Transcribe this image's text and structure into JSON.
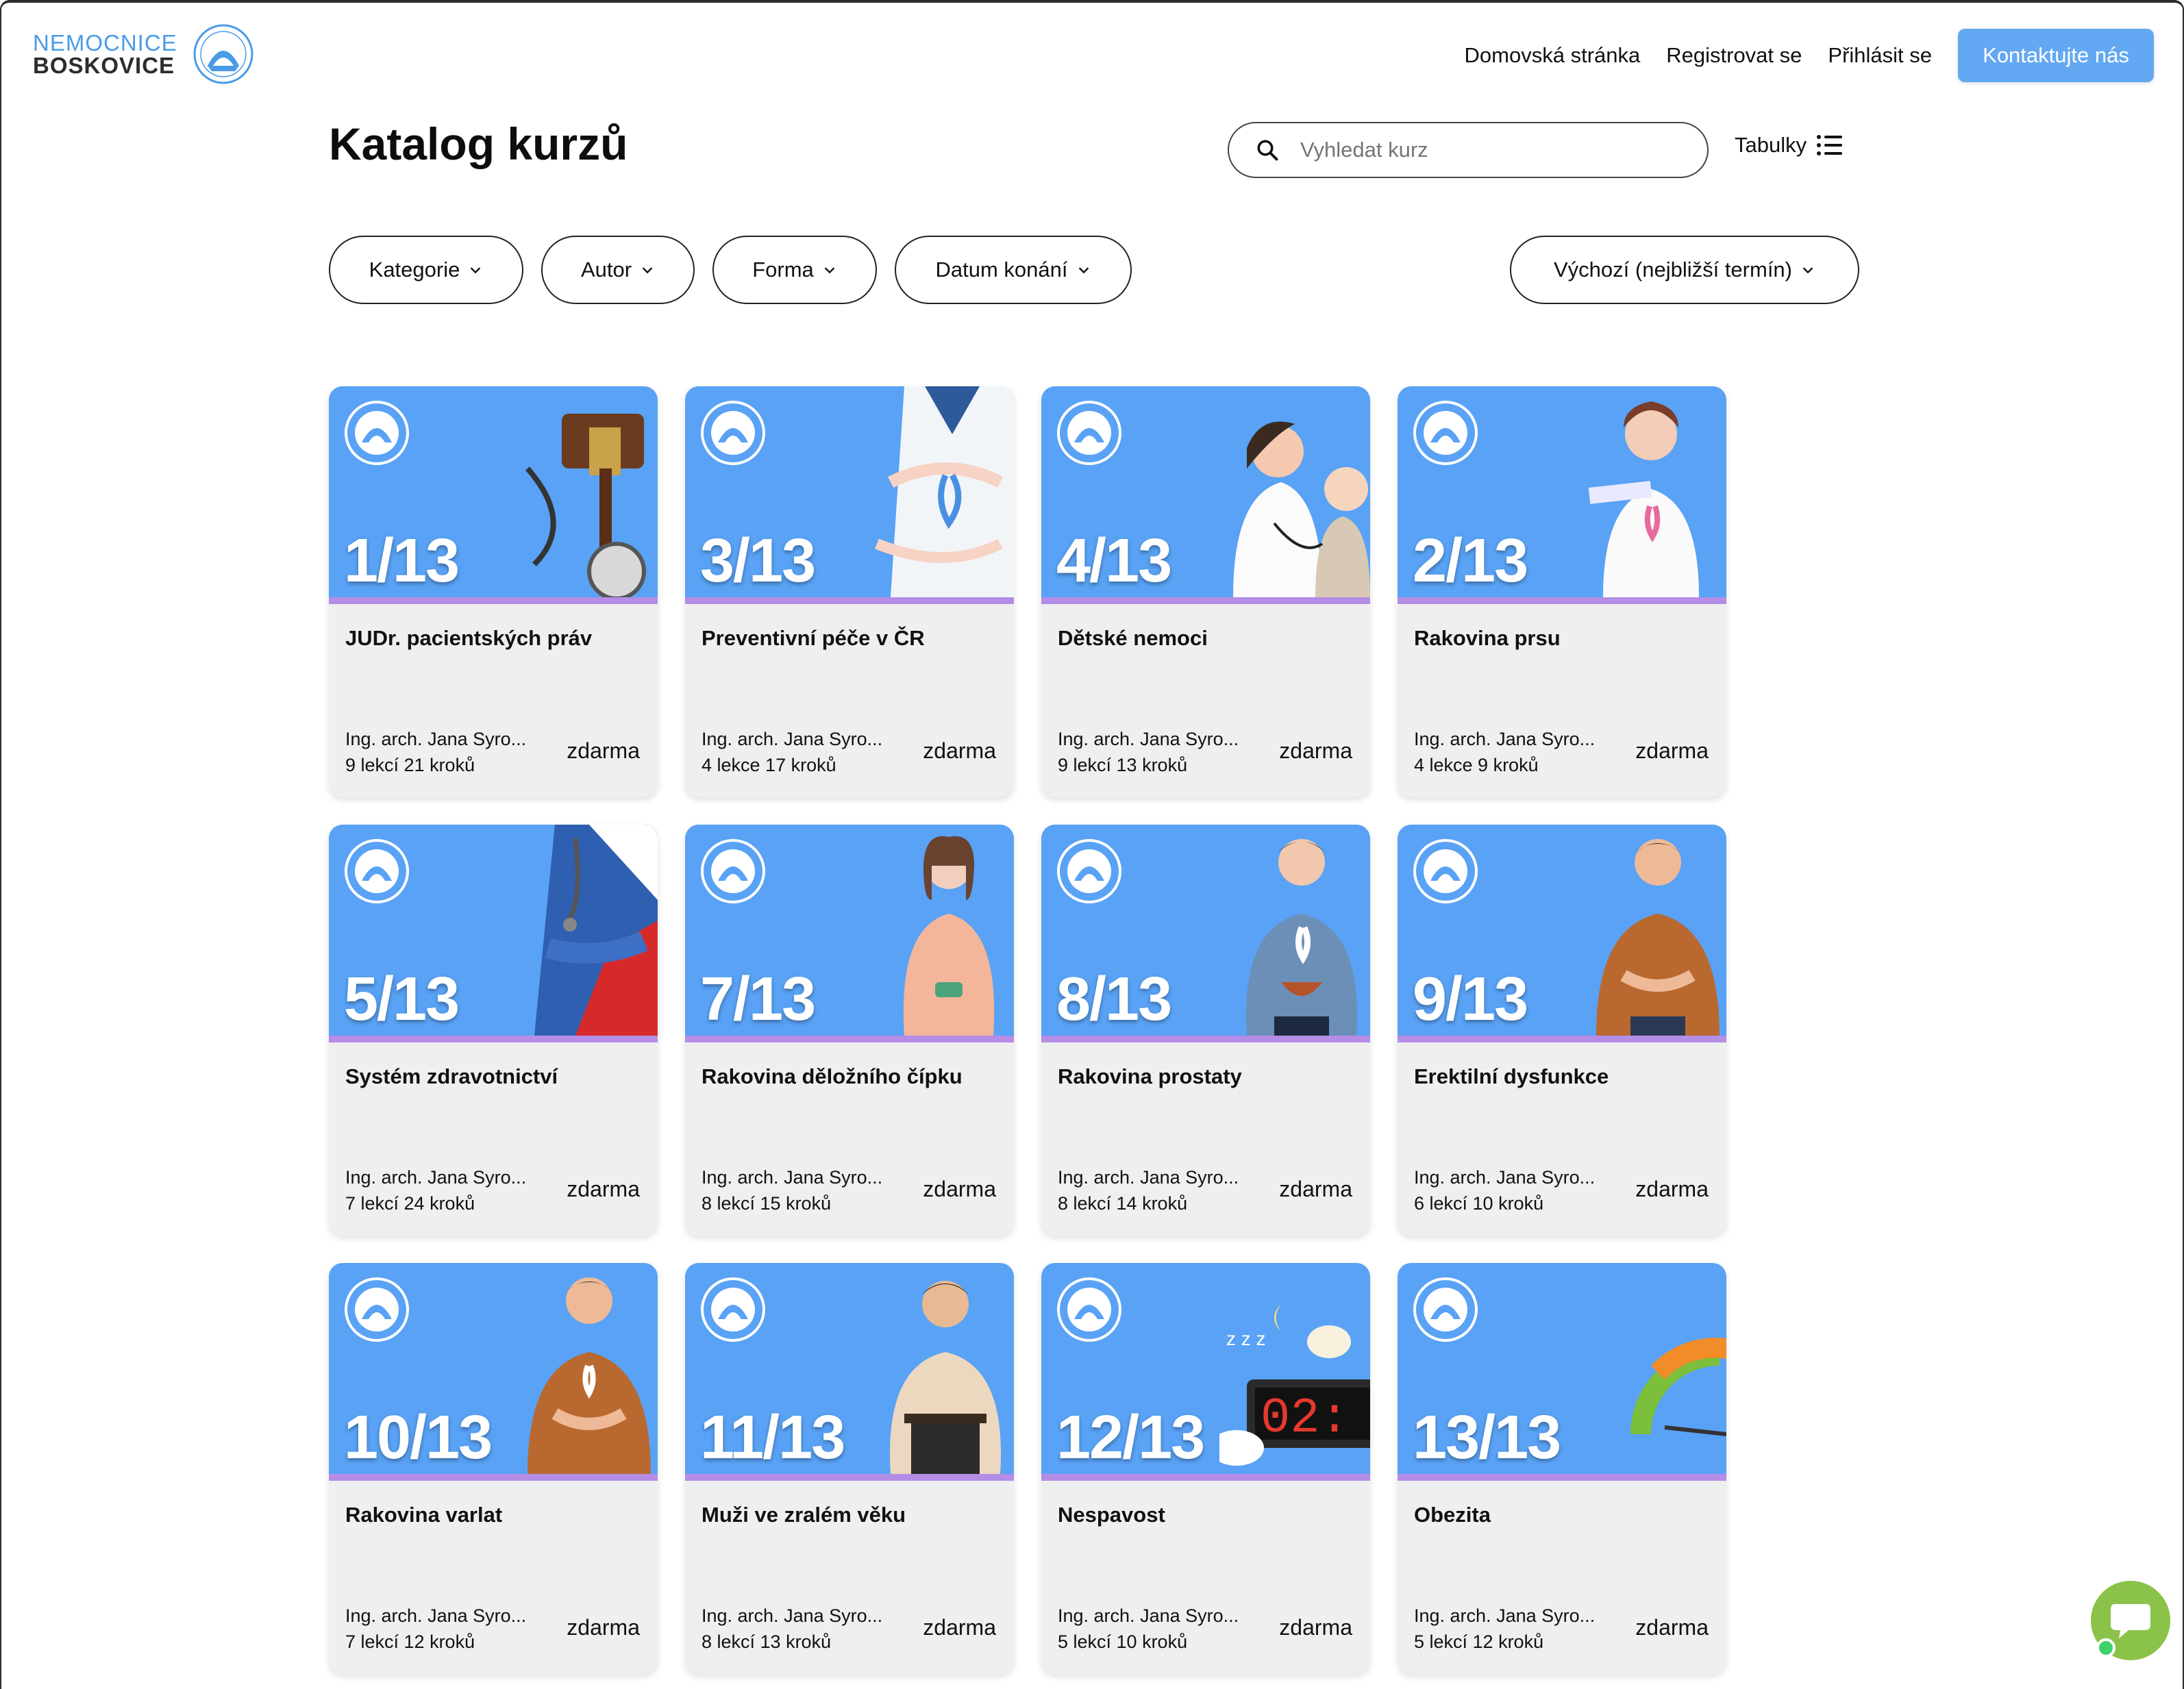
{
  "header": {
    "logo_line1": "NEMOCNICE",
    "logo_line2": "BOSKOVICE",
    "nav": [
      "Domovská stránka",
      "Registrovat se",
      "Přihlásit se"
    ],
    "contact_label": "Kontaktujte nás"
  },
  "page": {
    "title": "Katalog kurzů",
    "search_placeholder": "Vyhledat kurz",
    "tables_label": "Tabulky"
  },
  "filters": {
    "category": "Kategorie",
    "author": "Autor",
    "form": "Forma",
    "date": "Datum konání",
    "sort": "Výchozí (nejbližší termín)"
  },
  "colors": {
    "accent": "#63a8f2",
    "card_image_bg": "#59a2f5",
    "card_stripe": "#b48de6",
    "chat": "#8bc34a"
  },
  "courses": [
    {
      "num": "1/13",
      "title": "JUDr. pacientských práv",
      "author": "Ing. arch. Jana Syro...",
      "stats": "9 lekcí 21 kroků",
      "price": "zdarma",
      "icon": "gavel-stethoscope-image"
    },
    {
      "num": "3/13",
      "title": "Preventivní péče v ČR",
      "author": "Ing. arch. Jana Syro...",
      "stats": "4 lekce 17 kroků",
      "price": "zdarma",
      "icon": "doctor-ribbon-image"
    },
    {
      "num": "4/13",
      "title": "Dětské nemoci",
      "author": "Ing. arch. Jana Syro...",
      "stats": "9 lekcí 13 kroků",
      "price": "zdarma",
      "icon": "doctor-child-image"
    },
    {
      "num": "2/13",
      "title": "Rakovina prsu",
      "author": "Ing. arch. Jana Syro...",
      "stats": "4 lekce 9 kroků",
      "price": "zdarma",
      "icon": "doctor-pink-ribbon-image"
    },
    {
      "num": "5/13",
      "title": "Systém zdravotnictví",
      "author": "Ing. arch. Jana Syro...",
      "stats": "7 lekcí 24 kroků",
      "price": "zdarma",
      "icon": "doctor-flag-image"
    },
    {
      "num": "7/13",
      "title": "Rakovina děložního čípku",
      "author": "Ing. arch. Jana Syro...",
      "stats": "8 lekcí 15 kroků",
      "price": "zdarma",
      "icon": "woman-image"
    },
    {
      "num": "8/13",
      "title": "Rakovina prostaty",
      "author": "Ing. arch. Jana Syro...",
      "stats": "8 lekcí 14 kroků",
      "price": "zdarma",
      "icon": "man-ribbon-image"
    },
    {
      "num": "9/13",
      "title": "Erektilní dysfunkce",
      "author": "Ing. arch. Jana Syro...",
      "stats": "6 lekcí 10 kroků",
      "price": "zdarma",
      "icon": "man-orange-shirt-image"
    },
    {
      "num": "10/13",
      "title": "Rakovina varlat",
      "author": "Ing. arch. Jana Syro...",
      "stats": "7 lekcí 12 kroků",
      "price": "zdarma",
      "icon": "man-ribbon-orange-image"
    },
    {
      "num": "11/13",
      "title": "Muži ve zralém věku",
      "author": "Ing. arch. Jana Syro...",
      "stats": "8 lekcí 13 kroků",
      "price": "zdarma",
      "icon": "older-man-image"
    },
    {
      "num": "12/13",
      "title": "Nespavost",
      "author": "Ing. arch. Jana Syro...",
      "stats": "5 lekcí 10 kroků",
      "price": "zdarma",
      "icon": "alarm-clock-sheep-image",
      "clock": "02:"
    },
    {
      "num": "13/13",
      "title": "Obezita",
      "author": "Ing. arch. Jana Syro...",
      "stats": "5 lekcí 12 kroků",
      "price": "zdarma",
      "icon": "scale-gauge-image"
    }
  ]
}
